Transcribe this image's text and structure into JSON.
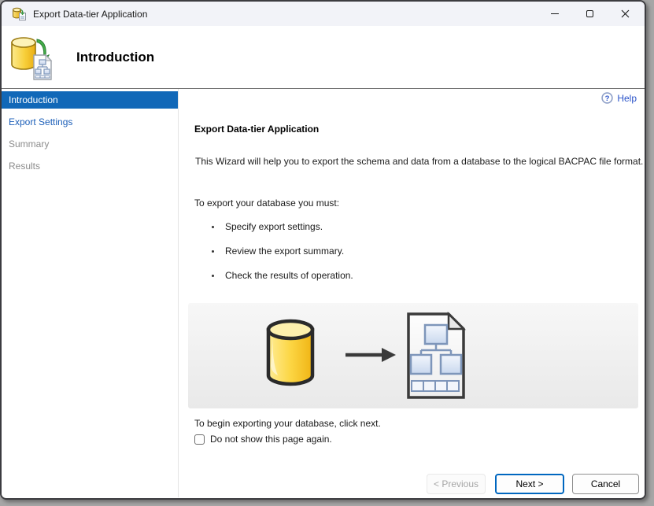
{
  "window": {
    "title": "Export Data-tier Application",
    "controls": [
      {
        "name": "minimize"
      },
      {
        "name": "maximize"
      },
      {
        "name": "close"
      }
    ]
  },
  "header": {
    "step_title": "Introduction"
  },
  "sidebar": {
    "items": [
      {
        "label": "Introduction",
        "state": "active"
      },
      {
        "label": "Export Settings",
        "state": "link"
      },
      {
        "label": "Summary",
        "state": "disabled"
      },
      {
        "label": "Results",
        "state": "disabled"
      }
    ]
  },
  "main": {
    "help_label": "Help",
    "heading": "Export Data-tier Application",
    "intro_text": "This Wizard will help you to export the schema and data from a database to the logical BACPAC file format.",
    "list_intro": "To export your database you must:",
    "bullets": [
      "Specify export settings.",
      "Review the export summary.",
      "Check the results of operation."
    ],
    "begin_text": "To begin exporting your database, click next.",
    "checkbox_label": "Do not show this page again.",
    "checkbox_checked": false
  },
  "footer": {
    "previous_label": "< Previous",
    "next_label": "Next >",
    "cancel_label": "Cancel"
  },
  "icons": {
    "titlebar": "database-export-icon",
    "header": "database-export-icon-large",
    "help": "question-circle-icon",
    "graphic": [
      "database-cylinder-icon",
      "arrow-right-icon",
      "bacpac-schema-file-icon"
    ]
  },
  "colors": {
    "accent_blue": "#1168b8",
    "link_blue": "#1b5eb8",
    "help_blue": "#2952c8",
    "next_accent": "#0067c0",
    "disabled_gray": "#8c8c8c"
  }
}
